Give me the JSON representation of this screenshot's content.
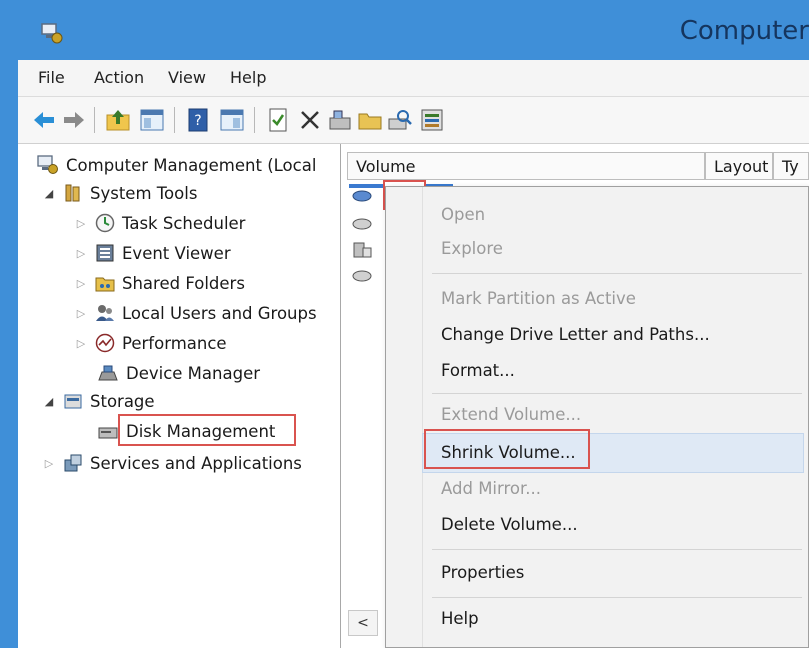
{
  "window": {
    "title": "Computer"
  },
  "menubar": {
    "items": [
      "File",
      "Action",
      "View",
      "Help"
    ]
  },
  "toolbar": {
    "buttons": [
      {
        "name": "back",
        "icon": "arrow-left-icon"
      },
      {
        "name": "forward",
        "icon": "arrow-right-icon"
      },
      {
        "name": "up-folder",
        "icon": "folder-up-icon"
      },
      {
        "name": "show-hide-tree",
        "icon": "console-tree-icon"
      },
      {
        "name": "help",
        "icon": "help-book-icon"
      },
      {
        "name": "show-hide-action-pane",
        "icon": "action-pane-icon"
      },
      {
        "name": "properties",
        "icon": "properties-icon"
      },
      {
        "name": "delete",
        "icon": "delete-x-icon"
      },
      {
        "name": "open-drive",
        "icon": "open-drive-icon"
      },
      {
        "name": "folder",
        "icon": "open-folder-icon"
      },
      {
        "name": "search",
        "icon": "search-drive-icon"
      },
      {
        "name": "settings",
        "icon": "settings-icon"
      }
    ]
  },
  "tree": {
    "root": "Computer Management (Local",
    "system_tools": "System Tools",
    "task_scheduler": "Task Scheduler",
    "event_viewer": "Event Viewer",
    "shared_folders": "Shared Folders",
    "local_users": "Local Users and Groups",
    "performance": "Performance",
    "device_manager": "Device Manager",
    "storage": "Storage",
    "disk_management": "Disk Management",
    "services": "Services and Applications"
  },
  "volume_list": {
    "columns": [
      "Volume",
      "Layout",
      "Ty"
    ]
  },
  "context_menu": {
    "items": [
      {
        "label": "Open",
        "enabled": false
      },
      {
        "label": "Explore",
        "enabled": false
      },
      {
        "label": "Mark Partition as Active",
        "enabled": false
      },
      {
        "label": "Change Drive Letter and Paths...",
        "enabled": true
      },
      {
        "label": "Format...",
        "enabled": true
      },
      {
        "label": "Extend Volume...",
        "enabled": false
      },
      {
        "label": "Shrink Volume...",
        "enabled": true,
        "highlighted": true
      },
      {
        "label": "Add Mirror...",
        "enabled": false
      },
      {
        "label": "Delete Volume...",
        "enabled": true
      },
      {
        "label": "Properties",
        "enabled": true
      },
      {
        "label": "Help",
        "enabled": true
      }
    ]
  },
  "colors": {
    "titlebar": "#3f8fd8",
    "highlight_box": "#d9534f",
    "menu_hover": "#dfe9f5"
  }
}
